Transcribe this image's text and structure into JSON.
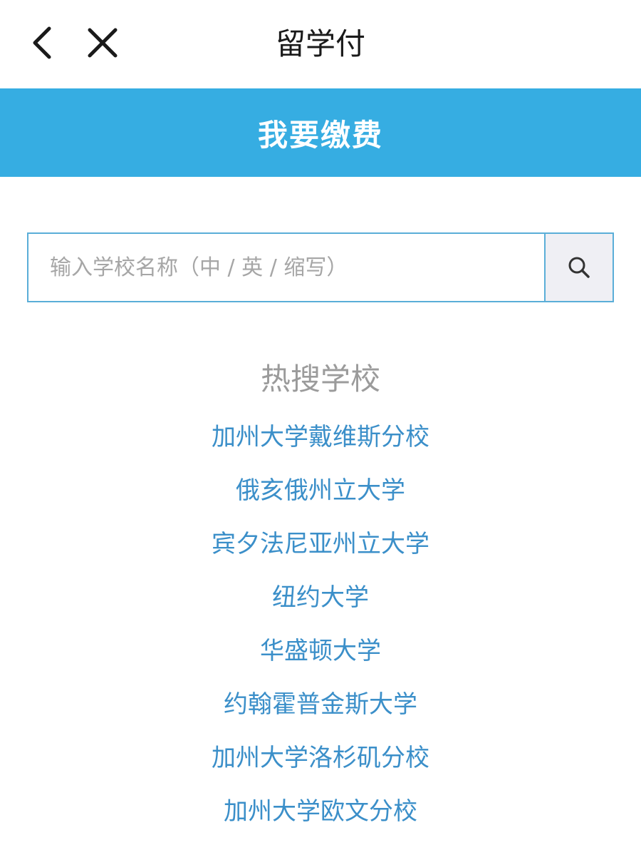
{
  "nav": {
    "title": "留学付",
    "back_icon": "chevron-left-icon",
    "close_icon": "close-icon"
  },
  "banner": {
    "title": "我要缴费",
    "color": "#36ade2"
  },
  "search": {
    "placeholder": "输入学校名称（中 / 英 / 缩写）",
    "value": "",
    "icon": "search-icon"
  },
  "hot": {
    "title": "热搜学校",
    "schools": [
      "加州大学戴维斯分校",
      "俄亥俄州立大学",
      "宾夕法尼亚州立大学",
      "纽约大学",
      "华盛顿大学",
      "约翰霍普金斯大学",
      "加州大学洛杉矶分校",
      "加州大学欧文分校"
    ]
  },
  "colors": {
    "accent": "#36ade2",
    "link": "#3b8fc9",
    "muted": "#9b9b9b"
  }
}
